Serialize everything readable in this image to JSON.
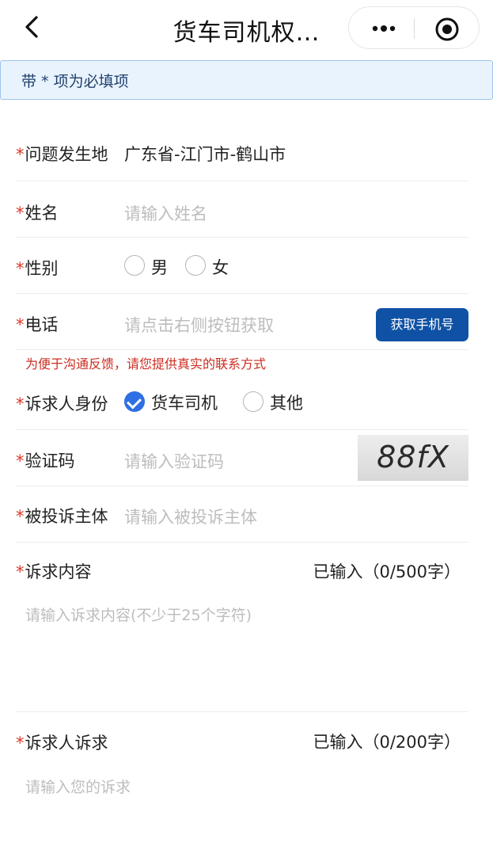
{
  "nav": {
    "title": "货车司机权…"
  },
  "notice": {
    "text": "带 * 项为必填项"
  },
  "form": {
    "required_mark": "*",
    "location": {
      "label": "问题发生地",
      "value": "广东省-江门市-鹤山市"
    },
    "name": {
      "label": "姓名",
      "placeholder": "请输入姓名"
    },
    "gender": {
      "label": "性别",
      "options": [
        "男",
        "女"
      ]
    },
    "phone": {
      "label": "电话",
      "placeholder": "请点击右侧按钮获取",
      "button": "获取手机号",
      "hint": "为便于沟通反馈，请您提供真实的联系方式"
    },
    "identity": {
      "label": "诉求人身份",
      "options": [
        "货车司机",
        "其他"
      ],
      "selected": "货车司机"
    },
    "captcha": {
      "label": "验证码",
      "placeholder": "请输入验证码",
      "image_text": "88fX"
    },
    "respondent": {
      "label": "被投诉主体",
      "placeholder": "请输入被投诉主体"
    },
    "content": {
      "label": "诉求内容",
      "counter": "已输入（0/500字）",
      "placeholder": "请输入诉求内容(不少于25个字符)"
    },
    "demand": {
      "label": "诉求人诉求",
      "counter": "已输入（0/200字）",
      "placeholder": "请输入您的诉求"
    }
  },
  "colors": {
    "accent": "#2e6fe4",
    "button": "#0f52a5",
    "required": "#d8392a",
    "notice_bg": "#e9f3fd"
  }
}
